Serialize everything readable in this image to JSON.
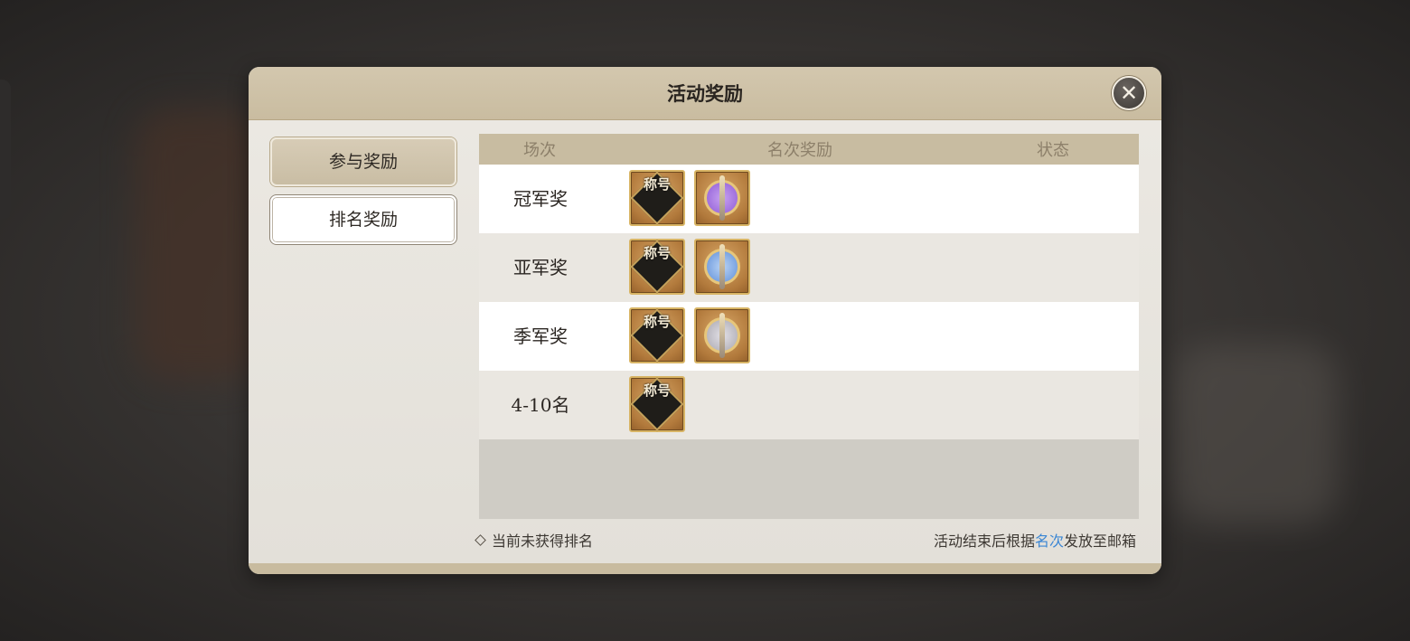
{
  "dialog": {
    "title": "活动奖励",
    "close_icon": "close-icon"
  },
  "sidebar": {
    "tabs": [
      {
        "label": "参与奖励",
        "active": true
      },
      {
        "label": "排名奖励",
        "active": false
      }
    ]
  },
  "table": {
    "headers": {
      "round": "场次",
      "reward": "名次奖励",
      "status": "状态"
    },
    "rows": [
      {
        "label": "冠军奖",
        "rewards": [
          "title-badge",
          "sword-emblem-purple"
        ],
        "status": ""
      },
      {
        "label": "亚军奖",
        "rewards": [
          "title-badge",
          "sword-emblem-blue"
        ],
        "status": ""
      },
      {
        "label": "季军奖",
        "rewards": [
          "title-badge",
          "sword-emblem-grey"
        ],
        "status": ""
      },
      {
        "label": "4-10名",
        "rewards": [
          "title-badge"
        ],
        "status": ""
      }
    ],
    "title_badge_text": "称号"
  },
  "footer": {
    "left_note": "当前未获得排名",
    "right_note_prefix": "活动结束后根据",
    "right_note_highlight": "名次",
    "right_note_suffix": "发放至邮箱"
  },
  "colors": {
    "header_bg": "#c9bca0",
    "highlight": "#3b86d4",
    "emblem_purple": "#8f5bd6",
    "emblem_blue": "#5f8fd8",
    "emblem_grey": "#a9a7b0"
  }
}
